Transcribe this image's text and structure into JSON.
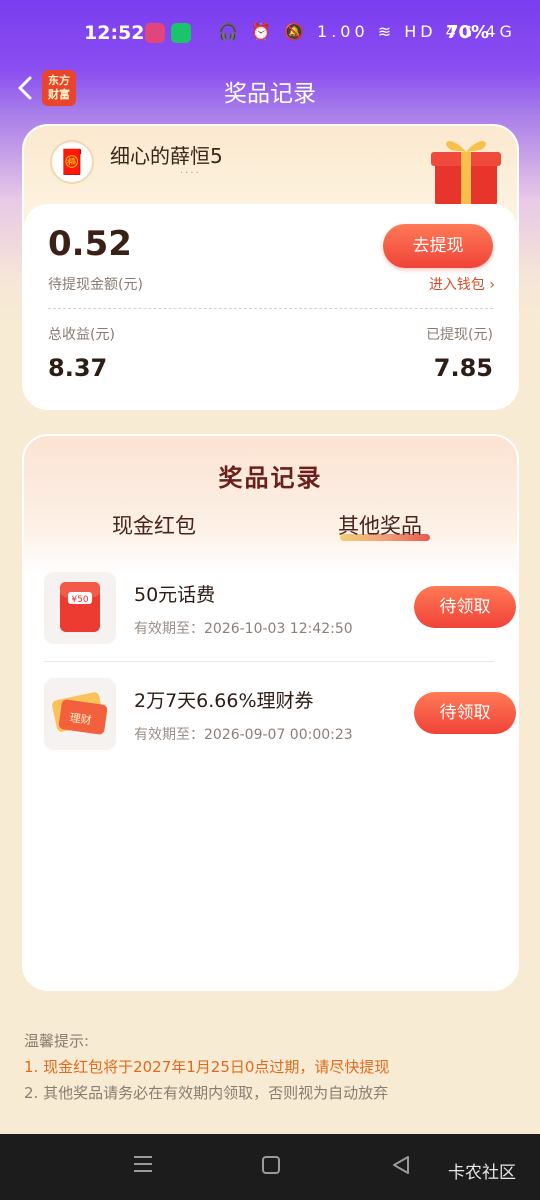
{
  "status_bar": {
    "time": "12:52",
    "icons": "🎧 ⏰ 🔕 1.00 ≋ HD 4G 4G",
    "battery": "70%"
  },
  "header": {
    "app_logo": "东方\n财富",
    "title": "奖品记录"
  },
  "profile": {
    "username": "细心的薛恒5",
    "username_sub": "····"
  },
  "balance": {
    "pending_amount": "0.52",
    "pending_label": "待提现金额(元)",
    "withdraw_button": "去提现",
    "wallet_link": "进入钱包 ›",
    "total_label": "总收益(元)",
    "total_value": "8.37",
    "withdrawn_label": "已提现(元)",
    "withdrawn_value": "7.85"
  },
  "records": {
    "title": "奖品记录",
    "tabs": [
      {
        "label": "现金红包",
        "active": false
      },
      {
        "label": "其他奖品",
        "active": true
      }
    ],
    "items": [
      {
        "name": "50元话费",
        "expiry_label": "有效期至：",
        "expiry": "2026-10-03 12:42:50",
        "button": "待领取",
        "icon": "red-envelope-icon",
        "icon_text": "¥50"
      },
      {
        "name": "2万7天6.66%理财券",
        "expiry_label": "有效期至：",
        "expiry": "2026-09-07 00:00:23",
        "button": "待领取",
        "icon": "coupon-ticket-icon",
        "icon_text": "理财"
      }
    ]
  },
  "tips": {
    "title": "温馨提示:",
    "items": [
      "1. 现金红包将于2027年1月25日0点过期，请尽快提现",
      "2. 其他奖品请务必在有效期内领取，否则视为自动放弃"
    ]
  },
  "nav": {
    "watermark": "卡农社区"
  },
  "colors": {
    "accent": "#f0433a",
    "header_purple": "#7a3df0",
    "page_bg": "#f7ecd3",
    "tip_orange": "#e26a1e"
  }
}
